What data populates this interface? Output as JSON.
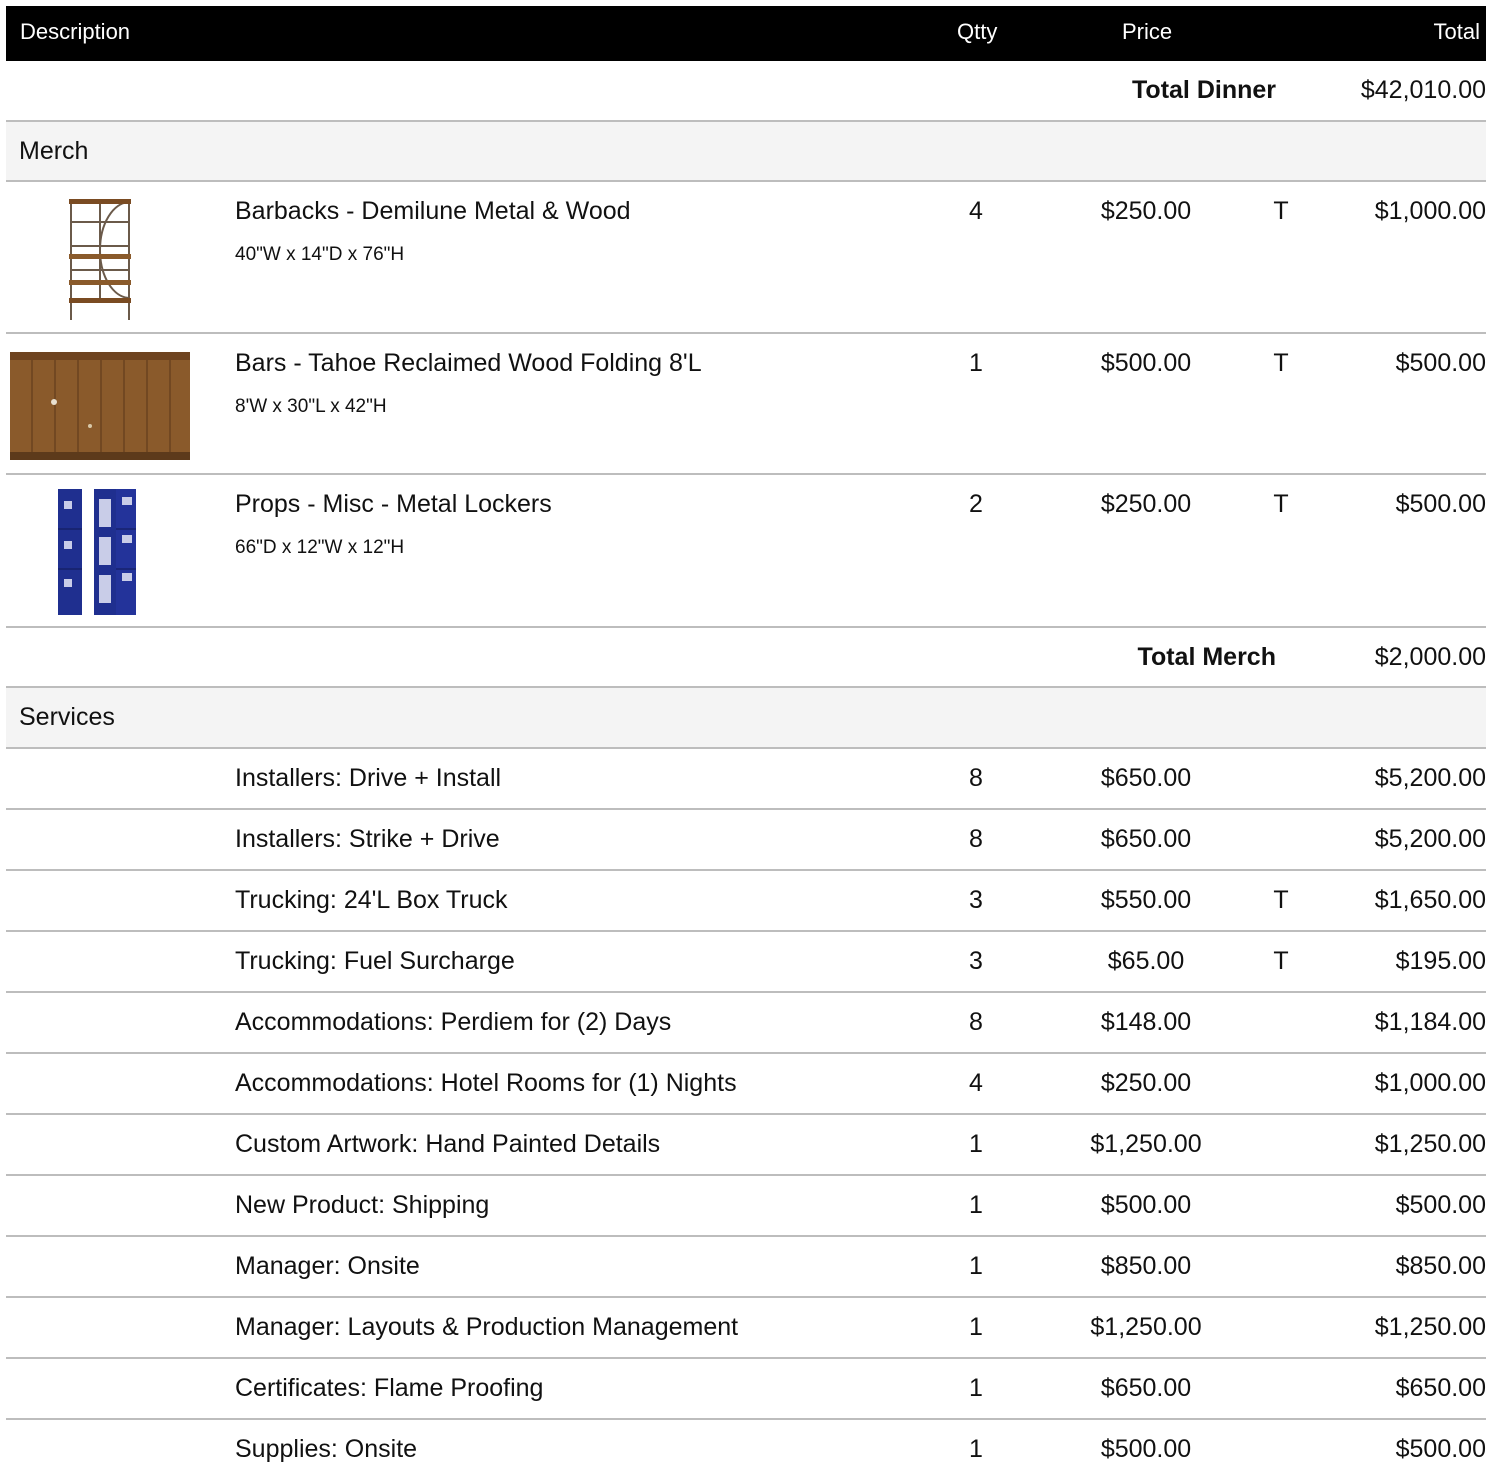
{
  "header": {
    "description": "Description",
    "qty": "Qtty",
    "price": "Price",
    "total": "Total"
  },
  "subtotal_dinner": {
    "label": "Total Dinner",
    "amount": "$42,010.00"
  },
  "merch": {
    "name": "Merch",
    "items": [
      {
        "desc": "Barbacks - Demilune Metal & Wood",
        "dims": "40\"W x 14\"D x 76\"H",
        "qty": "4",
        "price": "$250.00",
        "tax": "T",
        "total": "$1,000.00",
        "icon": "shelf-image"
      },
      {
        "desc": "Bars - Tahoe Reclaimed Wood Folding 8'L",
        "dims": "8'W x 30\"L x 42\"H",
        "qty": "1",
        "price": "$500.00",
        "tax": "T",
        "total": "$500.00",
        "icon": "bar-image"
      },
      {
        "desc": "Props - Misc - Metal Lockers",
        "dims": "66\"D x 12\"W x 12\"H",
        "qty": "2",
        "price": "$250.00",
        "tax": "T",
        "total": "$500.00",
        "icon": "locker-image"
      }
    ],
    "subtotal": {
      "label": "Total Merch",
      "amount": "$2,000.00"
    }
  },
  "services": {
    "name": "Services",
    "items": [
      {
        "desc": "Installers: Drive + Install",
        "qty": "8",
        "price": "$650.00",
        "tax": "",
        "total": "$5,200.00"
      },
      {
        "desc": "Installers: Strike + Drive",
        "qty": "8",
        "price": "$650.00",
        "tax": "",
        "total": "$5,200.00"
      },
      {
        "desc": "Trucking: 24'L Box Truck",
        "qty": "3",
        "price": "$550.00",
        "tax": "T",
        "total": "$1,650.00"
      },
      {
        "desc": "Trucking: Fuel Surcharge",
        "qty": "3",
        "price": "$65.00",
        "tax": "T",
        "total": "$195.00"
      },
      {
        "desc": "Accommodations: Perdiem for (2) Days",
        "qty": "8",
        "price": "$148.00",
        "tax": "",
        "total": "$1,184.00"
      },
      {
        "desc": "Accommodations: Hotel Rooms for (1) Nights",
        "qty": "4",
        "price": "$250.00",
        "tax": "",
        "total": "$1,000.00"
      },
      {
        "desc": "Custom Artwork: Hand Painted Details",
        "qty": "1",
        "price": "$1,250.00",
        "tax": "",
        "total": "$1,250.00"
      },
      {
        "desc": "New Product: Shipping",
        "qty": "1",
        "price": "$500.00",
        "tax": "",
        "total": "$500.00"
      },
      {
        "desc": "Manager: Onsite",
        "qty": "1",
        "price": "$850.00",
        "tax": "",
        "total": "$850.00"
      },
      {
        "desc": "Manager: Layouts & Production Management",
        "qty": "1",
        "price": "$1,250.00",
        "tax": "",
        "total": "$1,250.00"
      },
      {
        "desc": "Certificates: Flame Proofing",
        "qty": "1",
        "price": "$650.00",
        "tax": "",
        "total": "$650.00"
      },
      {
        "desc": "Supplies: Onsite",
        "qty": "1",
        "price": "$500.00",
        "tax": "",
        "total": "$500.00"
      }
    ]
  },
  "colors": {
    "header_bg": "#000000",
    "category_bg": "#f4f4f4",
    "divider": "#bdbdbd",
    "locker_blue": "#1f2f8f",
    "wood": "#8a5a2b"
  }
}
